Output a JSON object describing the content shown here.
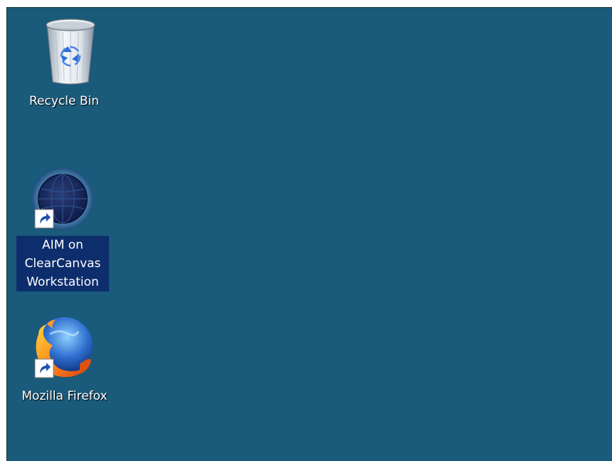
{
  "desktop": {
    "background": "#1a5a7a",
    "icons": [
      {
        "label": "Recycle Bin",
        "icon": "recycle-bin-icon",
        "shortcut": false,
        "selected": false
      },
      {
        "label": "AIM on ClearCanvas Workstation",
        "icon": "aim-clearcanvas-icon",
        "shortcut": true,
        "selected": true
      },
      {
        "label": "Mozilla Firefox",
        "icon": "firefox-icon",
        "shortcut": true,
        "selected": false
      }
    ]
  },
  "colors": {
    "desktop": "#1a5a7a",
    "selection": "#0d2d6c",
    "label_text": "#ffffff"
  }
}
